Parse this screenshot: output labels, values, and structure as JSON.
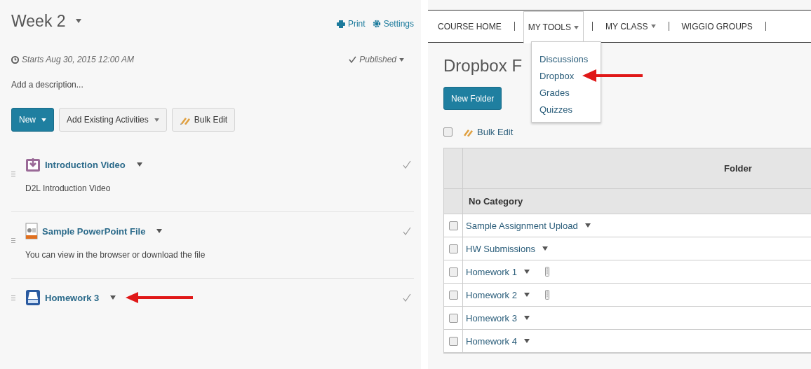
{
  "left_panel": {
    "title": "Week 2",
    "print": "Print",
    "settings": "Settings",
    "starts": "Starts Aug 30, 2015 12:00 AM",
    "status": "Published",
    "description_placeholder": "Add a description...",
    "buttons": [
      {
        "label": "New",
        "kind": "primary",
        "caret": true
      },
      {
        "label": "Add Existing Activities",
        "kind": "default",
        "caret": true
      },
      {
        "label": "Bulk Edit",
        "kind": "bulk",
        "caret": false
      }
    ],
    "activities": [
      {
        "kind": "video",
        "title": "Introduction Video",
        "description": "D2L Introduction Video",
        "pointer": false
      },
      {
        "kind": "file",
        "title": "Sample PowerPoint File",
        "description": "You can view in the browser or download the file",
        "pointer": false
      },
      {
        "kind": "dropbox",
        "title": "Homework 3",
        "pointer": true
      }
    ]
  },
  "right_panel": {
    "nav": [
      {
        "label": "COURSE HOME",
        "caret": false,
        "expanded": false
      },
      {
        "label": "MY TOOLS",
        "caret": true,
        "expanded": true
      },
      {
        "label": "MY CLASS",
        "caret": true,
        "expanded": false
      },
      {
        "label": "WIGGIO GROUPS",
        "caret": false,
        "expanded": false
      }
    ],
    "menu": [
      {
        "label": "Discussions",
        "pointer": false
      },
      {
        "label": "Dropbox",
        "pointer": true
      },
      {
        "label": "Grades",
        "pointer": false
      },
      {
        "label": "Quizzes",
        "pointer": false
      }
    ],
    "page_title": "Dropbox F",
    "new_folder": "New Folder",
    "bulk_edit": "Bulk Edit",
    "select_all_checked": false,
    "table": {
      "column": "Folder",
      "category": "No Category",
      "rows": [
        {
          "name": "Sample Assignment Upload",
          "checked": false,
          "attachment": false
        },
        {
          "name": "HW Submissions",
          "checked": false,
          "attachment": false
        },
        {
          "name": "Homework 1",
          "checked": false,
          "attachment": true
        },
        {
          "name": "Homework 2",
          "checked": false,
          "attachment": true
        },
        {
          "name": "Homework 3",
          "checked": false,
          "attachment": false
        },
        {
          "name": "Homework 4",
          "checked": false,
          "attachment": false
        }
      ]
    }
  }
}
